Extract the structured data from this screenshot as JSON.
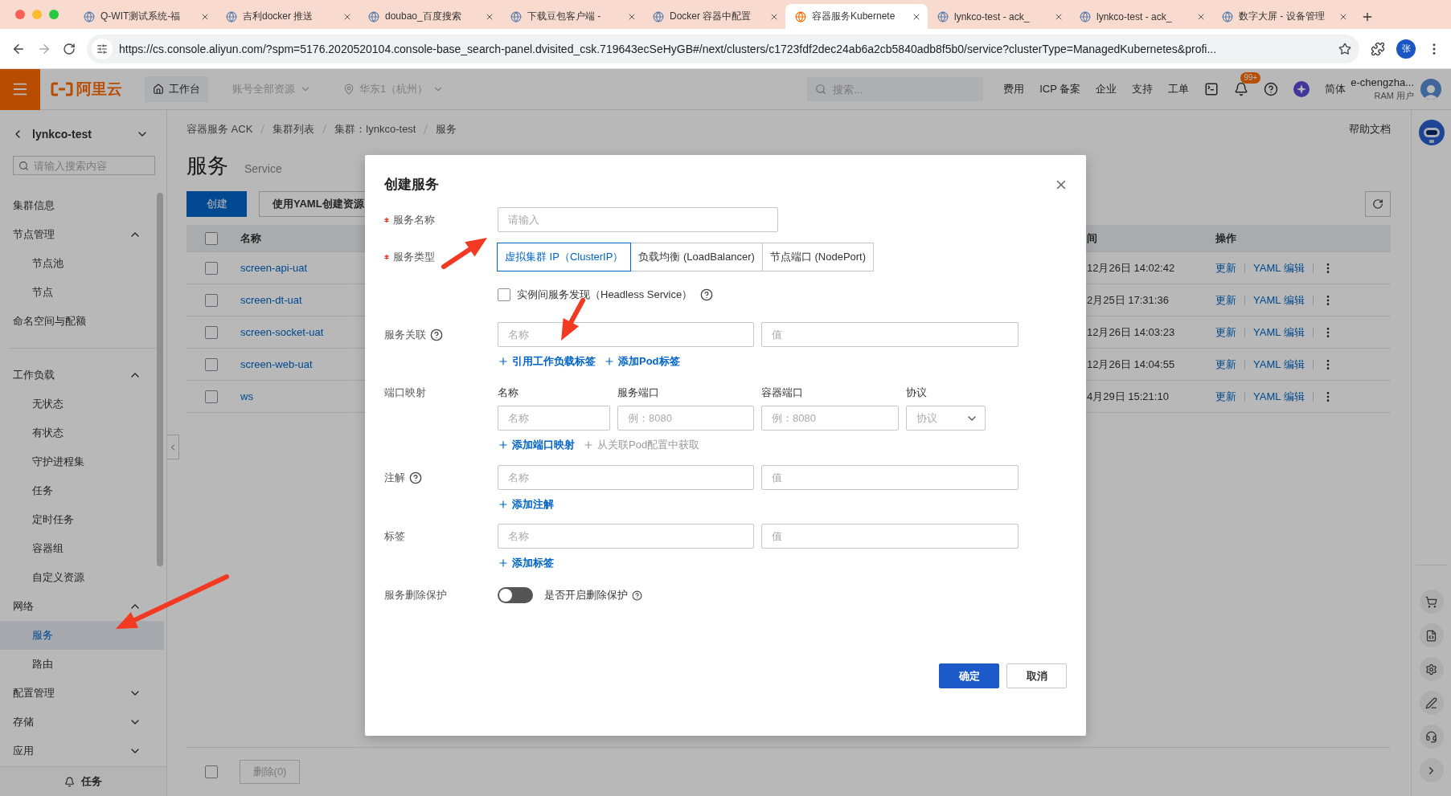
{
  "browser": {
    "tabs": [
      {
        "title": "Q-WIT测试系统-福",
        "selected": false
      },
      {
        "title": "吉利docker 推送",
        "selected": false
      },
      {
        "title": "doubao_百度搜索",
        "selected": false
      },
      {
        "title": "下载豆包客户端 -",
        "selected": false
      },
      {
        "title": "Docker 容器中配置",
        "selected": false
      },
      {
        "title": "容器服务Kubernete",
        "selected": true
      },
      {
        "title": "lynkco-test - ack_",
        "selected": false
      },
      {
        "title": "lynkco-test - ack_",
        "selected": false
      },
      {
        "title": "数字大屏 - 设备管理",
        "selected": false
      }
    ],
    "url": "https://cs.console.aliyun.com/?spm=5176.2020520104.console-base_search-panel.dvisited_csk.719643ecSeHyGB#/next/clusters/c1723fdf2dec24ab6a2cb5840adb8f5b0/service?clusterType=ManagedKubernetes&profi...",
    "profile": "张"
  },
  "topnav": {
    "logo": "阿里云",
    "home": "工作台",
    "account": {
      "label": "账号全部资源",
      "disabled": true
    },
    "region": {
      "label": "华东1（杭州）",
      "disabled": true
    },
    "search_placeholder": "搜索...",
    "links": [
      "费用",
      "ICP 备案",
      "企业",
      "支持",
      "工单"
    ],
    "notification_badge": "99+",
    "language": "简体",
    "user": {
      "name": "e-chengzha...",
      "role": "RAM 用户"
    }
  },
  "sidebar": {
    "cluster": "lynkco-test",
    "search_placeholder": "请输入搜索内容",
    "sections": [
      [
        {
          "label": "集群信息",
          "selected": false
        },
        {
          "label": "节点管理",
          "expanded": true,
          "children": [
            {
              "label": "节点池",
              "selected": false
            },
            {
              "label": "节点",
              "selected": false
            }
          ]
        },
        {
          "label": "命名空间与配额",
          "selected": false
        }
      ],
      [
        {
          "label": "工作负载",
          "expanded": true,
          "children": [
            {
              "label": "无状态",
              "selected": false
            },
            {
              "label": "有状态",
              "selected": false
            },
            {
              "label": "守护进程集",
              "selected": false
            },
            {
              "label": "任务",
              "selected": false
            },
            {
              "label": "定时任务",
              "selected": false
            },
            {
              "label": "容器组",
              "selected": false
            },
            {
              "label": "自定义资源",
              "selected": false
            }
          ]
        },
        {
          "label": "网络",
          "expanded": true,
          "children": [
            {
              "label": "服务",
              "selected": true
            },
            {
              "label": "路由",
              "selected": false
            }
          ]
        },
        {
          "label": "配置管理",
          "expanded": false
        },
        {
          "label": "存储",
          "expanded": false
        },
        {
          "label": "应用",
          "expanded": false
        }
      ]
    ],
    "footer": "任务"
  },
  "page": {
    "breadcrumb": [
      "容器服务 ACK",
      "集群列表",
      "集群：lynkco-test",
      "服务"
    ],
    "help": "帮助文档",
    "title": "服务",
    "subtitle": "Service",
    "buttons": [
      {
        "label": "创建",
        "kind": "primary"
      },
      {
        "label": "使用YAML创建资源",
        "kind": "default"
      }
    ],
    "table": {
      "columns": [
        "名称",
        "间",
        "操作"
      ],
      "header_checked": false,
      "rows": [
        {
          "checked": false,
          "name": "screen-api-uat",
          "column_3": "12月26日 14:02:42",
          "actions": [
            "更新",
            "YAML 编辑"
          ]
        },
        {
          "checked": false,
          "name": "screen-dt-uat",
          "column_3": "2月25日 17:31:36",
          "actions": [
            "更新",
            "YAML 编辑"
          ]
        },
        {
          "checked": false,
          "name": "screen-socket-uat",
          "column_3": "12月26日 14:03:23",
          "actions": [
            "更新",
            "YAML 编辑"
          ]
        },
        {
          "checked": false,
          "name": "screen-web-uat",
          "column_3": "12月26日 14:04:55",
          "actions": [
            "更新",
            "YAML 编辑"
          ]
        },
        {
          "checked": false,
          "name": "ws",
          "column_3": "4月29日 15:21:10",
          "actions": [
            "更新",
            "YAML 编辑"
          ]
        }
      ]
    },
    "footer": {
      "checked": false,
      "delete": {
        "label": "删除(0)",
        "disabled": true
      }
    }
  },
  "dialog": {
    "title": "创建服务",
    "name": {
      "label": "服务名称",
      "required": true,
      "placeholder": "请输入"
    },
    "type": {
      "label": "服务类型",
      "required": true,
      "options": [
        {
          "label": "虚拟集群 IP（ClusterIP）",
          "selected": true
        },
        {
          "label": "负载均衡 (LoadBalancer)",
          "selected": false
        },
        {
          "label": "节点端口 (NodePort)",
          "selected": false
        }
      ]
    },
    "headless": {
      "label": "实例间服务发现（Headless Service）",
      "checked": false,
      "help": true
    },
    "selector": {
      "label": "服务关联",
      "help": true,
      "key_placeholder": "名称",
      "value_placeholder": "值",
      "links": [
        {
          "label": "引用工作负载标签",
          "disabled": false
        },
        {
          "label": "添加Pod标签",
          "disabled": false
        }
      ]
    },
    "ports": {
      "label": "端口映射",
      "columns": [
        "名称",
        "服务端口",
        "容器端口",
        "协议"
      ],
      "placeholders": [
        "名称",
        "例：8080",
        "例：8080",
        "协议"
      ],
      "links": [
        {
          "label": "添加端口映射",
          "disabled": false
        },
        {
          "label": "从关联Pod配置中获取",
          "disabled": true
        }
      ]
    },
    "annotations": {
      "label": "注解",
      "help": true,
      "key_placeholder": "名称",
      "value_placeholder": "值",
      "links": [
        {
          "label": "添加注解",
          "disabled": false
        }
      ]
    },
    "labels": {
      "label": "标签",
      "key_placeholder": "名称",
      "value_placeholder": "值",
      "links": [
        {
          "label": "添加标签",
          "disabled": false
        }
      ]
    },
    "protection": {
      "label": "服务删除保护",
      "on": false,
      "text": "是否开启删除保护",
      "help": true
    },
    "buttons": [
      {
        "label": "确定",
        "kind": "primary"
      },
      {
        "label": "取消",
        "kind": "default"
      }
    ]
  }
}
